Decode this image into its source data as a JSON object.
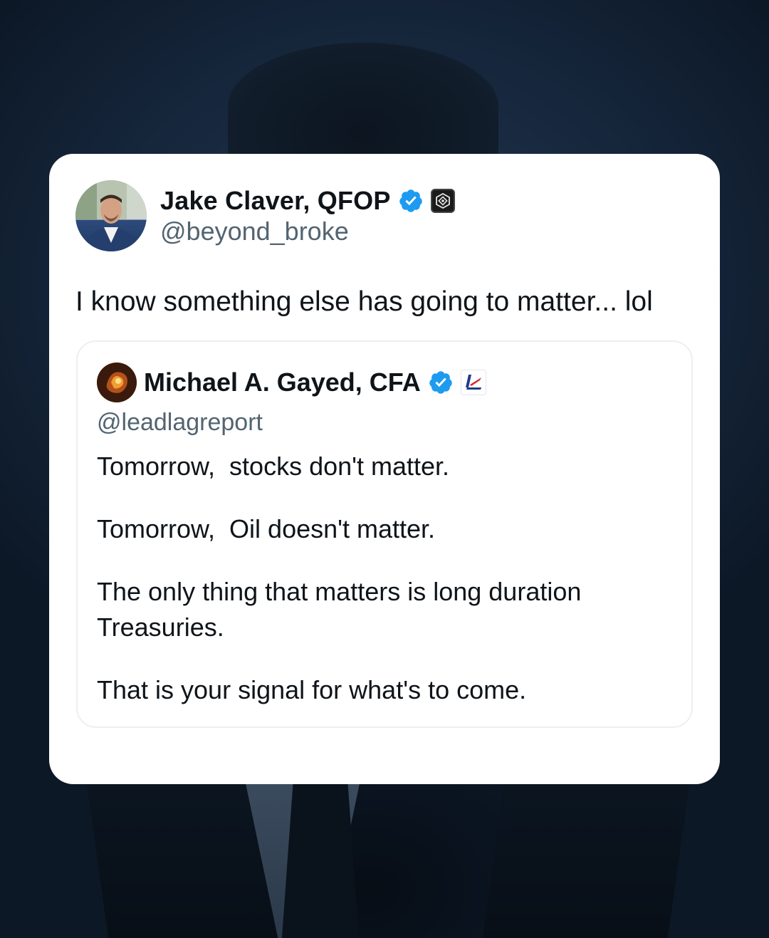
{
  "tweet": {
    "author": {
      "display_name": "Jake Claver, QFOP",
      "handle": "@beyond_broke",
      "verified_icon": "verified-badge-icon",
      "affiliation_icon": "affiliate-badge-icon"
    },
    "text": "I know something else has going to matter... lol",
    "quoted": {
      "author": {
        "display_name": "Michael A. Gayed, CFA",
        "handle": "@leadlagreport",
        "verified_icon": "verified-badge-icon",
        "affiliation_icon": "leadlag-logo-icon"
      },
      "paragraphs": [
        "Tomorrow,  stocks don't matter.",
        "Tomorrow,  Oil doesn't matter.",
        "The only thing that matters is long duration Treasuries.",
        "That is your signal for what's to come."
      ]
    }
  },
  "colors": {
    "verified_blue": "#1d9bf0",
    "text_primary": "#0f1419",
    "text_secondary": "#536471",
    "background": "#15253a"
  }
}
